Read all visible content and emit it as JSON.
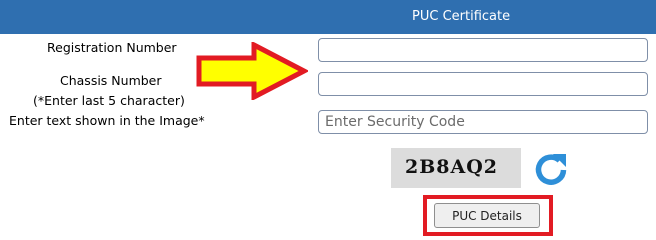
{
  "header": {
    "title": "PUC Certificate",
    "bg_color": "#2f6fb0"
  },
  "form": {
    "registration_label": "Registration Number",
    "registration_value": "",
    "chassis_label": "Chassis Number",
    "chassis_note": "(*Enter last 5 character)",
    "chassis_value": "",
    "captcha_label": "Enter text shown in the Image*",
    "captcha_placeholder": "Enter Security Code",
    "captcha_value": ""
  },
  "captcha": {
    "text": "2B8AQ2",
    "refresh_icon": "refresh-icon",
    "refresh_color": "#2e8fd8"
  },
  "actions": {
    "submit_label": "PUC Details",
    "highlight_color": "#e21b23"
  },
  "annotation": {
    "arrow_icon": "arrow-right-icon",
    "arrow_fill": "#ffff00",
    "arrow_stroke": "#e21b23"
  }
}
